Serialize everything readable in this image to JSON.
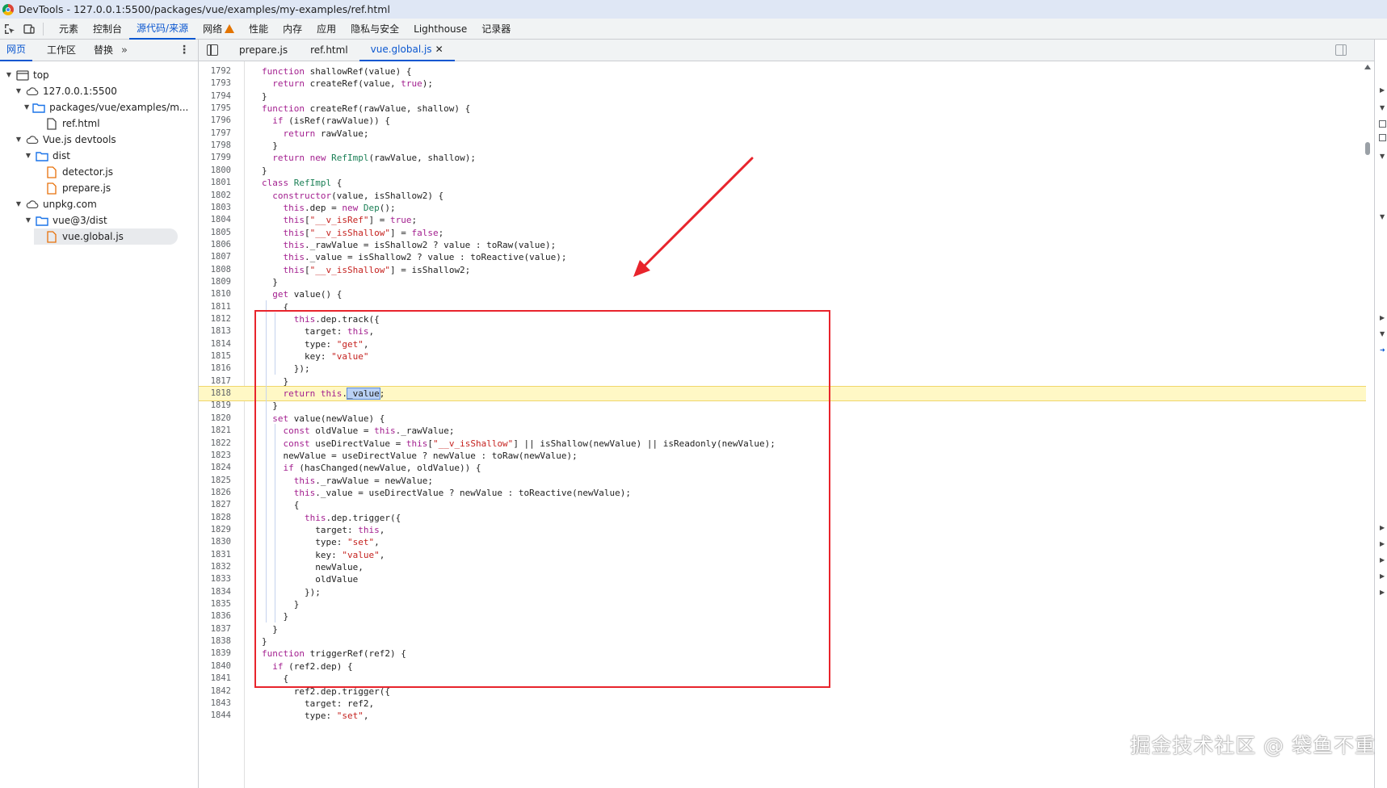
{
  "window": {
    "title": "DevTools - 127.0.0.1:5500/packages/vue/examples/my-examples/ref.html"
  },
  "toolbar": {
    "inspect_icon": "inspect-element-icon",
    "device_icon": "device-toolbar-icon"
  },
  "main_tabs": [
    {
      "label": "元素"
    },
    {
      "label": "控制台"
    },
    {
      "label": "源代码/来源"
    },
    {
      "label": "网络"
    },
    {
      "label": "性能"
    },
    {
      "label": "内存"
    },
    {
      "label": "应用"
    },
    {
      "label": "隐私与安全"
    },
    {
      "label": "Lighthouse"
    },
    {
      "label": "记录器"
    }
  ],
  "active_main_tab": "源代码/来源",
  "sidebar": {
    "tabs": [
      {
        "label": "网页"
      },
      {
        "label": "工作区"
      },
      {
        "label": "替换"
      }
    ],
    "more": "»",
    "tree": [
      {
        "label": "top",
        "type": "frame",
        "depth": 0
      },
      {
        "label": "127.0.0.1:5500",
        "type": "cloud",
        "depth": 1
      },
      {
        "label": "packages/vue/examples/m...",
        "type": "folder",
        "depth": 2
      },
      {
        "label": "ref.html",
        "type": "file-plain",
        "depth": 3
      },
      {
        "label": "Vue.js devtools",
        "type": "cloud",
        "depth": 1
      },
      {
        "label": "dist",
        "type": "folder",
        "depth": 2
      },
      {
        "label": "detector.js",
        "type": "file-js",
        "depth": 3
      },
      {
        "label": "prepare.js",
        "type": "file-js",
        "depth": 3
      },
      {
        "label": "unpkg.com",
        "type": "cloud",
        "depth": 1
      },
      {
        "label": "vue@3/dist",
        "type": "folder",
        "depth": 2
      },
      {
        "label": "vue.global.js",
        "type": "file-js",
        "depth": 3,
        "selected": true
      }
    ]
  },
  "editor": {
    "tabs": [
      {
        "label": "prepare.js"
      },
      {
        "label": "ref.html"
      },
      {
        "label": "vue.global.js",
        "active": true,
        "closable": true
      }
    ],
    "highlighted_line": 1818,
    "lines": [
      {
        "n": "1792",
        "code": "function shallowRef(value) {"
      },
      {
        "n": "1793",
        "code": "  return createRef(value, true);"
      },
      {
        "n": "1794",
        "code": "}"
      },
      {
        "n": "1795",
        "code": "function createRef(rawValue, shallow) {"
      },
      {
        "n": "1796",
        "code": "  if (isRef(rawValue)) {"
      },
      {
        "n": "1797",
        "code": "    return rawValue;"
      },
      {
        "n": "1798",
        "code": "  }"
      },
      {
        "n": "1799",
        "code": "  return new RefImpl(rawValue, shallow);"
      },
      {
        "n": "1800",
        "code": "}"
      },
      {
        "n": "1801",
        "code": "class RefImpl {"
      },
      {
        "n": "1802",
        "code": "  constructor(value, isShallow2) {"
      },
      {
        "n": "1803",
        "code": "    this.dep = new Dep();"
      },
      {
        "n": "1804",
        "code": "    this[\"__v_isRef\"] = true;"
      },
      {
        "n": "1805",
        "code": "    this[\"__v_isShallow\"] = false;"
      },
      {
        "n": "1806",
        "code": "    this._rawValue = isShallow2 ? value : toRaw(value);"
      },
      {
        "n": "1807",
        "code": "    this._value = isShallow2 ? value : toReactive(value);"
      },
      {
        "n": "1808",
        "code": "    this[\"__v_isShallow\"] = isShallow2;"
      },
      {
        "n": "1809",
        "code": "  }"
      },
      {
        "n": "1810",
        "code": "  get value() {"
      },
      {
        "n": "1811",
        "code": "    {"
      },
      {
        "n": "1812",
        "code": "      this.dep.track({"
      },
      {
        "n": "1813",
        "code": "        target: this,"
      },
      {
        "n": "1814",
        "code": "        type: \"get\","
      },
      {
        "n": "1815",
        "code": "        key: \"value\""
      },
      {
        "n": "1816",
        "code": "      });"
      },
      {
        "n": "1817",
        "code": "    }"
      },
      {
        "n": "1818",
        "code": "    return this._value;"
      },
      {
        "n": "1819",
        "code": "  }"
      },
      {
        "n": "1820",
        "code": "  set value(newValue) {"
      },
      {
        "n": "1821",
        "code": "    const oldValue = this._rawValue;"
      },
      {
        "n": "1822",
        "code": "    const useDirectValue = this[\"__v_isShallow\"] || isShallow(newValue) || isReadonly(newValue);"
      },
      {
        "n": "1823",
        "code": "    newValue = useDirectValue ? newValue : toRaw(newValue);"
      },
      {
        "n": "1824",
        "code": "    if (hasChanged(newValue, oldValue)) {"
      },
      {
        "n": "1825",
        "code": "      this._rawValue = newValue;"
      },
      {
        "n": "1826",
        "code": "      this._value = useDirectValue ? newValue : toReactive(newValue);"
      },
      {
        "n": "1827",
        "code": "      {"
      },
      {
        "n": "1828",
        "code": "        this.dep.trigger({"
      },
      {
        "n": "1829",
        "code": "          target: this,"
      },
      {
        "n": "1830",
        "code": "          type: \"set\","
      },
      {
        "n": "1831",
        "code": "          key: \"value\","
      },
      {
        "n": "1832",
        "code": "          newValue,"
      },
      {
        "n": "1833",
        "code": "          oldValue"
      },
      {
        "n": "1834",
        "code": "        });"
      },
      {
        "n": "1835",
        "code": "      }"
      },
      {
        "n": "1836",
        "code": "    }"
      },
      {
        "n": "1837",
        "code": "  }"
      },
      {
        "n": "1838",
        "code": "}"
      },
      {
        "n": "1839",
        "code": "function triggerRef(ref2) {"
      },
      {
        "n": "1840",
        "code": "  if (ref2.dep) {"
      },
      {
        "n": "1841",
        "code": "    {"
      },
      {
        "n": "1842",
        "code": "      ref2.dep.trigger({"
      },
      {
        "n": "1843",
        "code": "        target: ref2,"
      },
      {
        "n": "1844",
        "code": "        type: \"set\","
      }
    ]
  },
  "annotation": {
    "color": "#e8242c"
  },
  "watermark": "掘金技术社区 @ 袋鱼不重"
}
